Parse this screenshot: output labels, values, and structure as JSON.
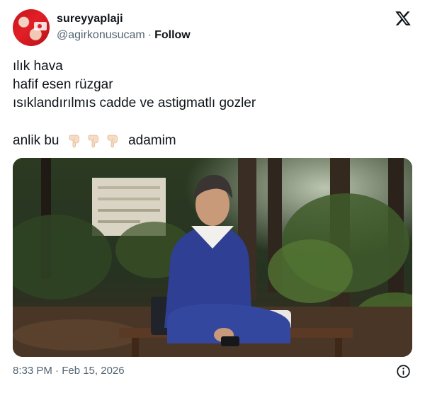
{
  "author": {
    "display_name": "sureyyaplaji",
    "handle": "@agirkonusucam",
    "separator": "·",
    "follow_label": "Follow"
  },
  "brand_icon": "x-logo-icon",
  "tweet": {
    "lines": [
      "ılık hava",
      "hafif esen rüzgar",
      "ısıklandırılmıs cadde ve astigmatlı gozler"
    ],
    "last_line_start": "anlik bu",
    "last_line_emojis": [
      "pointing-down-hand-icon",
      "pointing-down-hand-icon",
      "pointing-down-hand-icon"
    ],
    "last_line_end": "adamim"
  },
  "media": {
    "description_icon": "photo-man-in-blue-coverall-sitting-on-bench-in-forest"
  },
  "meta": {
    "timestamp": "8:33 PM · Feb 15, 2026",
    "info_icon": "info-icon"
  },
  "colors": {
    "text": "#0f1419",
    "secondary": "#536471",
    "background": "#ffffff"
  }
}
